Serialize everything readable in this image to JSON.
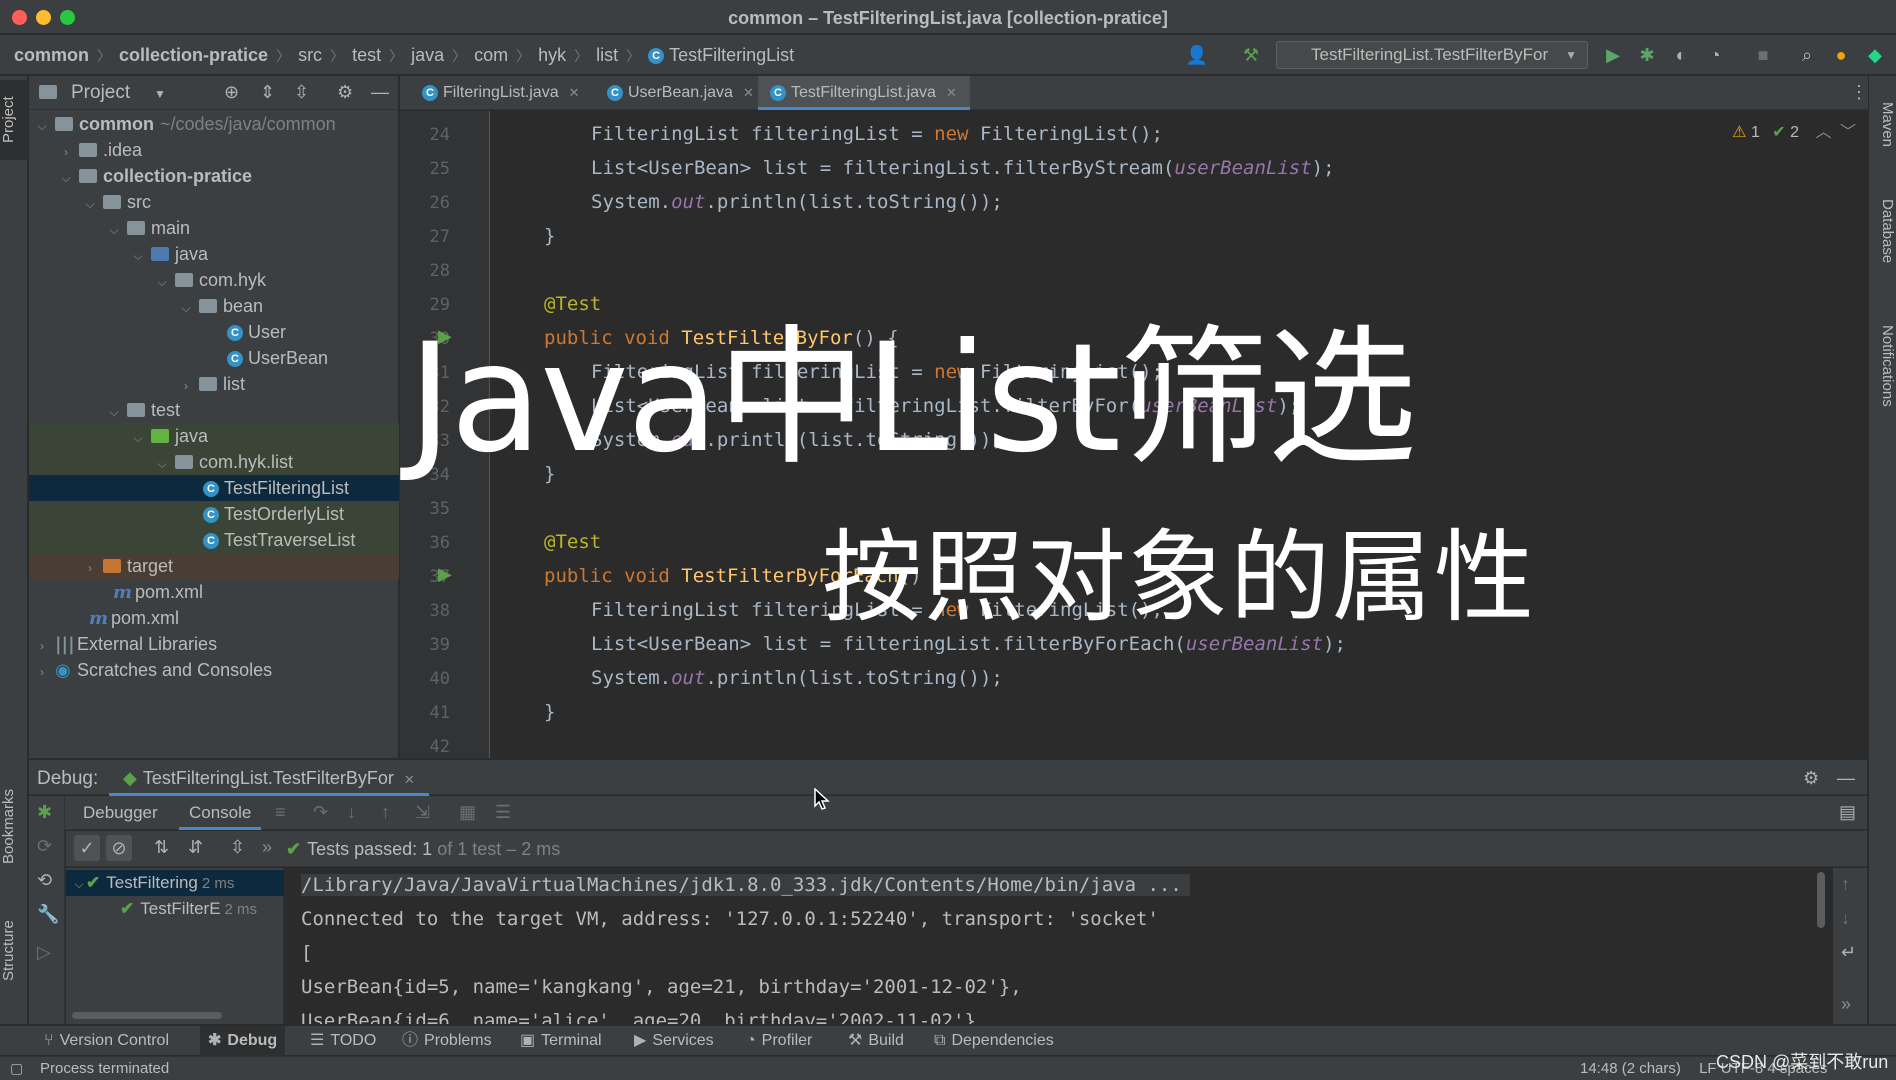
{
  "window": {
    "title": "common – TestFilteringList.java [collection-pratice]",
    "colors": {
      "close": "#ff5f57",
      "minimize": "#febc2e",
      "zoom": "#28c840",
      "accent": "#4a88c7"
    }
  },
  "breadcrumb": [
    "common",
    "collection-pratice",
    "src",
    "test",
    "java",
    "com",
    "hyk",
    "list",
    "TestFilteringList"
  ],
  "run_config": {
    "label": "TestFilteringList.TestFilterByFor"
  },
  "left_strip": {
    "project_tab": "Project",
    "bookmarks_tab": "Bookmarks",
    "structure_tab": "Structure"
  },
  "right_strip": {
    "maven_tab": "Maven",
    "database_tab": "Database",
    "notifications_tab": "Notifications"
  },
  "project_panel": {
    "title": "Project",
    "tree": [
      {
        "label": "common",
        "secondary": "~/codes/java/common"
      },
      {
        "label": ".idea"
      },
      {
        "label": "collection-pratice"
      },
      {
        "label": "src"
      },
      {
        "label": "main"
      },
      {
        "label": "java"
      },
      {
        "label": "com.hyk"
      },
      {
        "label": "bean"
      },
      {
        "label": "User"
      },
      {
        "label": "UserBean"
      },
      {
        "label": "list"
      },
      {
        "label": "test"
      },
      {
        "label": "java"
      },
      {
        "label": "com.hyk.list"
      },
      {
        "label": "TestFilteringList"
      },
      {
        "label": "TestOrderlyList"
      },
      {
        "label": "TestTraverseList"
      },
      {
        "label": "target"
      },
      {
        "label": "pom.xml"
      },
      {
        "label": "pom.xml"
      },
      {
        "label": "External Libraries"
      },
      {
        "label": "Scratches and Consoles"
      }
    ]
  },
  "editor": {
    "tabs": [
      "FilteringList.java",
      "UserBean.java",
      "TestFilteringList.java"
    ],
    "active_tab": "TestFilteringList.java",
    "inspections": {
      "warnings": "1",
      "weak_warnings": "2"
    },
    "line_numbers": [
      "24",
      "25",
      "26",
      "27",
      "28",
      "29",
      "30",
      "31",
      "32",
      "33",
      "34",
      "35",
      "36",
      "37",
      "38",
      "39",
      "40",
      "41",
      "42"
    ],
    "code": {
      "l24_a": "FilteringList filteringList = ",
      "l24_kw": "new",
      "l24_b": " FilteringList();",
      "l25_a": "List<UserBean> list = filteringList.filterByStream(",
      "l25_it": "userBeanList",
      "l25_b": ");",
      "l26_a": "System.",
      "l26_it": "out",
      "l26_b": ".println(list.toString());",
      "l27": "}",
      "l29": "@Test",
      "l30_kw": "public void ",
      "l30_fn": "TestFilterByFor",
      "l30_b": "() {",
      "l31_a": "FilteringList filteringList = ",
      "l31_kw": "new",
      "l31_b": " FilteringList();",
      "l32_a": "List<UserBean> list = filteringList.filterByFor(",
      "l32_it": "userBeanList",
      "l32_b": ");",
      "l33_a": "System.",
      "l33_it": "out",
      "l33_b": ".println(list.toString());",
      "l34": "}",
      "l36": "@Test",
      "l37_kw": "public void ",
      "l37_fn": "TestFilterByForEach",
      "l37_b": "() {",
      "l38_a": "FilteringList filteringList = ",
      "l38_kw": "new",
      "l38_b": " FilteringList();",
      "l39_a": "List<UserBean> list = filteringList.filterByForEach(",
      "l39_it": "userBeanList",
      "l39_b": ");",
      "l40_a": "System.",
      "l40_it": "out",
      "l40_b": ".println(list.toString());",
      "l41": "}"
    }
  },
  "overlay": {
    "title": "Java中List筛选",
    "subtitle": "按照对象的属性"
  },
  "debug": {
    "label": "Debug:",
    "session_tab": "TestFilteringList.TestFilterByFor",
    "tabs": [
      "Debugger",
      "Console"
    ],
    "active_tab": "Console",
    "tests_passed": "Tests passed:",
    "tests_count": "1",
    "tests_detail": "of 1 test – 2 ms",
    "test_tree": [
      {
        "label": "TestFiltering",
        "time": "2 ms"
      },
      {
        "label": "TestFilterE",
        "time": "2 ms"
      }
    ],
    "console_lines": [
      "/Library/Java/JavaVirtualMachines/jdk1.8.0_333.jdk/Contents/Home/bin/java ...",
      "Connected to the target VM, address: '127.0.0.1:52240', transport: 'socket'",
      "[",
      "UserBean{id=5, name='kangkang', age=21, birthday='2001-12-02'},",
      "UserBean{id=6, name='alice', age=20, birthday='2002-11-02'},"
    ]
  },
  "tool_tabs": [
    "Version Control",
    "Debug",
    "TODO",
    "Problems",
    "Terminal",
    "Services",
    "Profiler",
    "Build",
    "Dependencies"
  ],
  "status": {
    "text": "Process terminated",
    "position": "14:48 (2 chars)",
    "encoding": "LF  UTF-8  4 spaces"
  },
  "watermark": "CSDN @菜到不敢run"
}
